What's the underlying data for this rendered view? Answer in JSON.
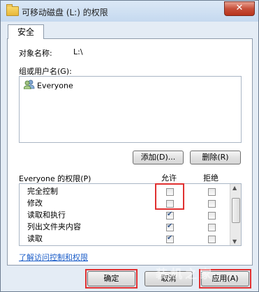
{
  "window": {
    "title": "可移动磁盘 (L:) 的权限",
    "close_label": "✕"
  },
  "tabs": [
    {
      "label": "安全"
    }
  ],
  "object": {
    "label": "对象名称:",
    "value": "L:\\"
  },
  "groups": {
    "label": "组或用户名(G):",
    "items": [
      {
        "name": "Everyone",
        "icon": "users-icon"
      }
    ]
  },
  "buttons": {
    "add": "添加(D)...",
    "remove": "删除(R)",
    "ok": "确定",
    "cancel": "取消",
    "apply": "应用(A)"
  },
  "permissions": {
    "label": "Everyone 的权限(P)",
    "allow_header": "允许",
    "deny_header": "拒绝",
    "rows": [
      {
        "name": "完全控制",
        "allow": false,
        "deny": false
      },
      {
        "name": "修改",
        "allow": false,
        "deny": false
      },
      {
        "name": "读取和执行",
        "allow": true,
        "deny": false
      },
      {
        "name": "列出文件夹内容",
        "allow": true,
        "deny": false
      },
      {
        "name": "读取",
        "allow": true,
        "deny": false
      }
    ]
  },
  "link": {
    "text": "了解访问控制和权限"
  },
  "watermark": {
    "text": "装机之家"
  },
  "colors": {
    "highlight": "#e03030",
    "link": "#1a5cc8"
  }
}
